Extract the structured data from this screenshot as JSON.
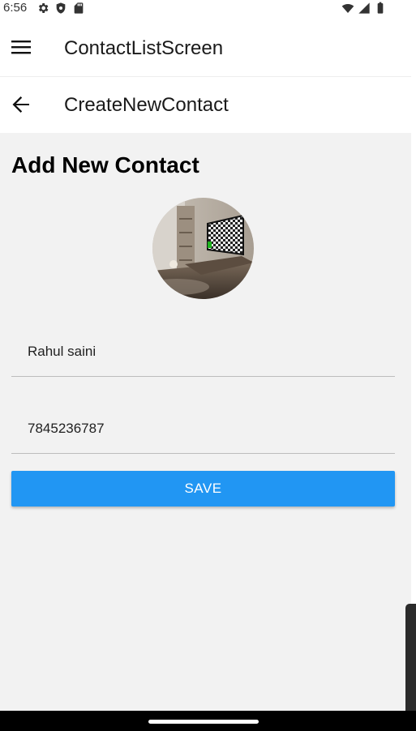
{
  "status_bar": {
    "time": "6:56",
    "left_icons": [
      "gear-icon",
      "shield-icon",
      "sd-card-icon"
    ],
    "right_icons": [
      "wifi-icon",
      "signal-icon",
      "battery-icon"
    ]
  },
  "app_bar": {
    "menu_icon": "menu-icon",
    "title": "ContactListScreen"
  },
  "sub_bar": {
    "back_icon": "arrow-back-icon",
    "title": "CreateNewContact"
  },
  "form": {
    "heading": "Add New Contact",
    "name_value": "Rahul saini",
    "phone_value": "7845236787",
    "save_label": "SAVE"
  },
  "colors": {
    "accent": "#2196f3",
    "background": "#f2f2f2",
    "surface": "#ffffff"
  }
}
